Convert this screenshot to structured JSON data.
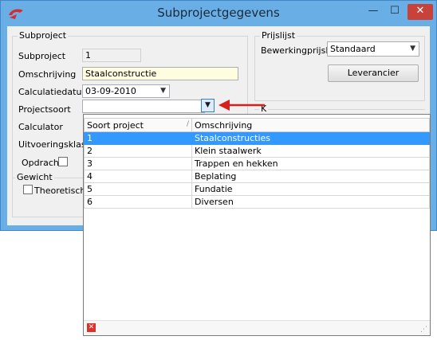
{
  "window": {
    "title": "Subprojectgegevens",
    "controls": {
      "minimize": "—",
      "maximize": "☐",
      "close": "✕"
    },
    "accent_color": "#6aaee6"
  },
  "subproject": {
    "group_title": "Subproject",
    "subproject_label": "Subproject",
    "subproject_value": "1",
    "omschrijving_label": "Omschrijving",
    "omschrijving_value": "Staalconstructie",
    "calculatiedatum_label": "Calculatiedatum",
    "calculatiedatum_value": "03-09-2010",
    "projectsoort_label": "Projectsoort",
    "projectsoort_value": "",
    "calculator_label": "Calculator",
    "uitvoeringsklasse_label": "Uitvoeringsklasse",
    "opdracht_label": "Opdracht",
    "gewicht_group_title": "Gewicht",
    "theoretisch_label": "Theoretisch"
  },
  "prijslijst": {
    "group_title": "Prijslijst",
    "bewerking_label": "Bewerkingprijslijst",
    "bewerking_value": "Standaard",
    "leverancier_button": "Leverancier",
    "partial_label": "K"
  },
  "dropdown_list": {
    "columns": [
      "Soort project",
      "Omschrijving"
    ],
    "rows": [
      {
        "code": "1",
        "omschrijving": "Staalconstructies",
        "selected": true
      },
      {
        "code": "2",
        "omschrijving": "Klein staalwerk",
        "selected": false
      },
      {
        "code": "3",
        "omschrijving": "Trappen en hekken",
        "selected": false
      },
      {
        "code": "4",
        "omschrijving": "Beplating",
        "selected": false
      },
      {
        "code": "5",
        "omschrijving": "Fundatie",
        "selected": false
      },
      {
        "code": "6",
        "omschrijving": "Diversen",
        "selected": false
      }
    ],
    "selection_color": "#3399ff"
  },
  "icons": {
    "app": "app-logo-icon",
    "dropdown_arrow": "chevron-down-icon",
    "annotation_arrow": "red-arrow-icon",
    "footer_close": "close-icon"
  }
}
